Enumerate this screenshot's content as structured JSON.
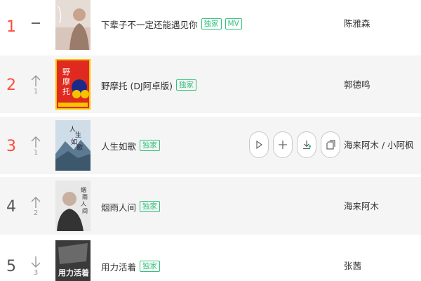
{
  "songs": [
    {
      "rank": "1",
      "trend": "flat",
      "change": "",
      "title": "下辈子不一定还能遇见你",
      "tags": [
        "独家",
        "MV"
      ],
      "artist": "陈雅森"
    },
    {
      "rank": "2",
      "trend": "up",
      "change": "1",
      "title": "野摩托 (DJ阿卓版)",
      "tags": [
        "独家"
      ],
      "artist": "郭德鸣",
      "cover_text": [
        "野",
        "摩",
        "托"
      ]
    },
    {
      "rank": "3",
      "trend": "up",
      "change": "1",
      "title": "人生如歌",
      "tags": [
        "独家"
      ],
      "artist": "海来阿木 / 小阿枫",
      "cover_text": [
        "人",
        "生",
        "如",
        "歌"
      ]
    },
    {
      "rank": "4",
      "trend": "up",
      "change": "2",
      "title": "烟雨人间",
      "tags": [
        "独家"
      ],
      "artist": "海来阿木",
      "cover_text": [
        "烟",
        "雨",
        "人",
        "间"
      ]
    },
    {
      "rank": "5",
      "trend": "down",
      "change": "3",
      "title": "用力活着",
      "tags": [
        "独家"
      ],
      "artist": "张茜",
      "cover_text": [
        "用",
        "力",
        "活",
        "着"
      ]
    }
  ],
  "colors": {
    "accent": "#31c27c",
    "rank_top": "#ff4a3d",
    "row_alt": "#f5f5f5"
  },
  "hover_actions": [
    {
      "icon": "play-icon"
    },
    {
      "icon": "add-icon"
    },
    {
      "icon": "download-icon"
    },
    {
      "icon": "share-icon"
    }
  ]
}
